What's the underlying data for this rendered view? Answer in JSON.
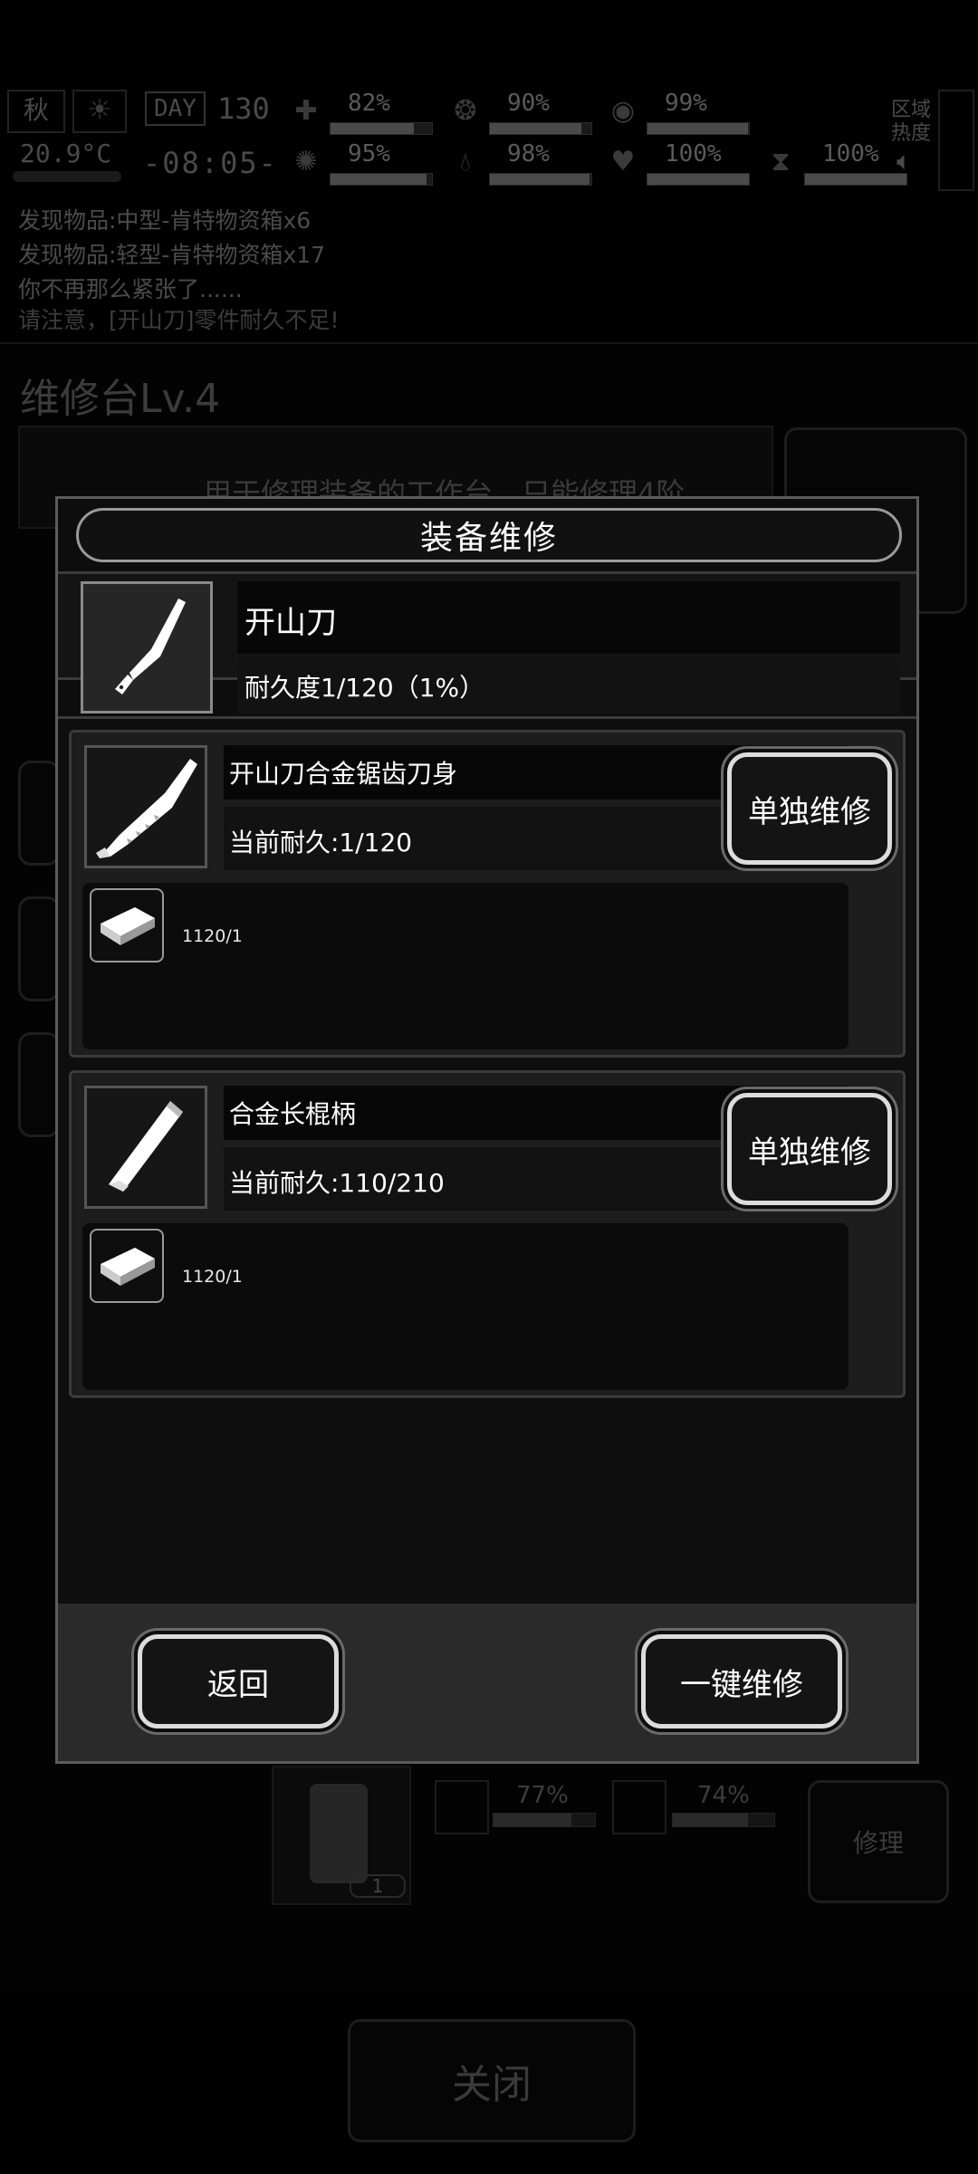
{
  "hud": {
    "season": "秋",
    "day_label": "DAY",
    "day_number": "130",
    "temperature": "20.9°C",
    "clock": "-08:05-",
    "stats": [
      {
        "icon": "first-aid-icon",
        "percent": "82%",
        "fraction": 0.82
      },
      {
        "icon": "stomach-icon",
        "percent": "90%",
        "fraction": 0.9
      },
      {
        "icon": "energy-icon",
        "percent": "99%",
        "fraction": 0.99
      },
      {
        "icon": "brain-icon",
        "percent": "95%",
        "fraction": 0.95
      },
      {
        "icon": "water-drop-icon",
        "percent": "98%",
        "fraction": 0.98
      },
      {
        "icon": "heart-icon",
        "percent": "100%",
        "fraction": 1.0
      },
      {
        "icon": "hourglass-icon",
        "percent": "100%",
        "fraction": 1.0
      }
    ],
    "zone_heat_label": "区域热度"
  },
  "log": {
    "lines": [
      "发现物品:中型-肯特物资箱x6",
      "发现物品:轻型-肯特物资箱x17",
      "你不再那么紧张了......",
      "请注意，[开山刀]零件耐久不足!"
    ]
  },
  "background": {
    "bench_title": "维修台Lv.4",
    "bench_desc": "用于修理装备的工作台，只能修理4阶",
    "bottom_item_pct_1": "77%",
    "bottom_item_pct_2": "74%",
    "bottom_count": "1",
    "repair_label": "修理",
    "close_label": "关闭"
  },
  "modal": {
    "title": "装备维修",
    "item": {
      "name": "开山刀",
      "durability": "耐久度1/120（1%）"
    },
    "parts": [
      {
        "name": "开山刀合金锯齿刀身",
        "durability": "当前耐久:1/120",
        "material_qty": "1120/1",
        "repair_label": "单独维修"
      },
      {
        "name": "合金长棍柄",
        "durability": "当前耐久:110/210",
        "material_qty": "1120/1",
        "repair_label": "单独维修"
      }
    ],
    "back_label": "返回",
    "repair_all_label": "一键维修"
  }
}
